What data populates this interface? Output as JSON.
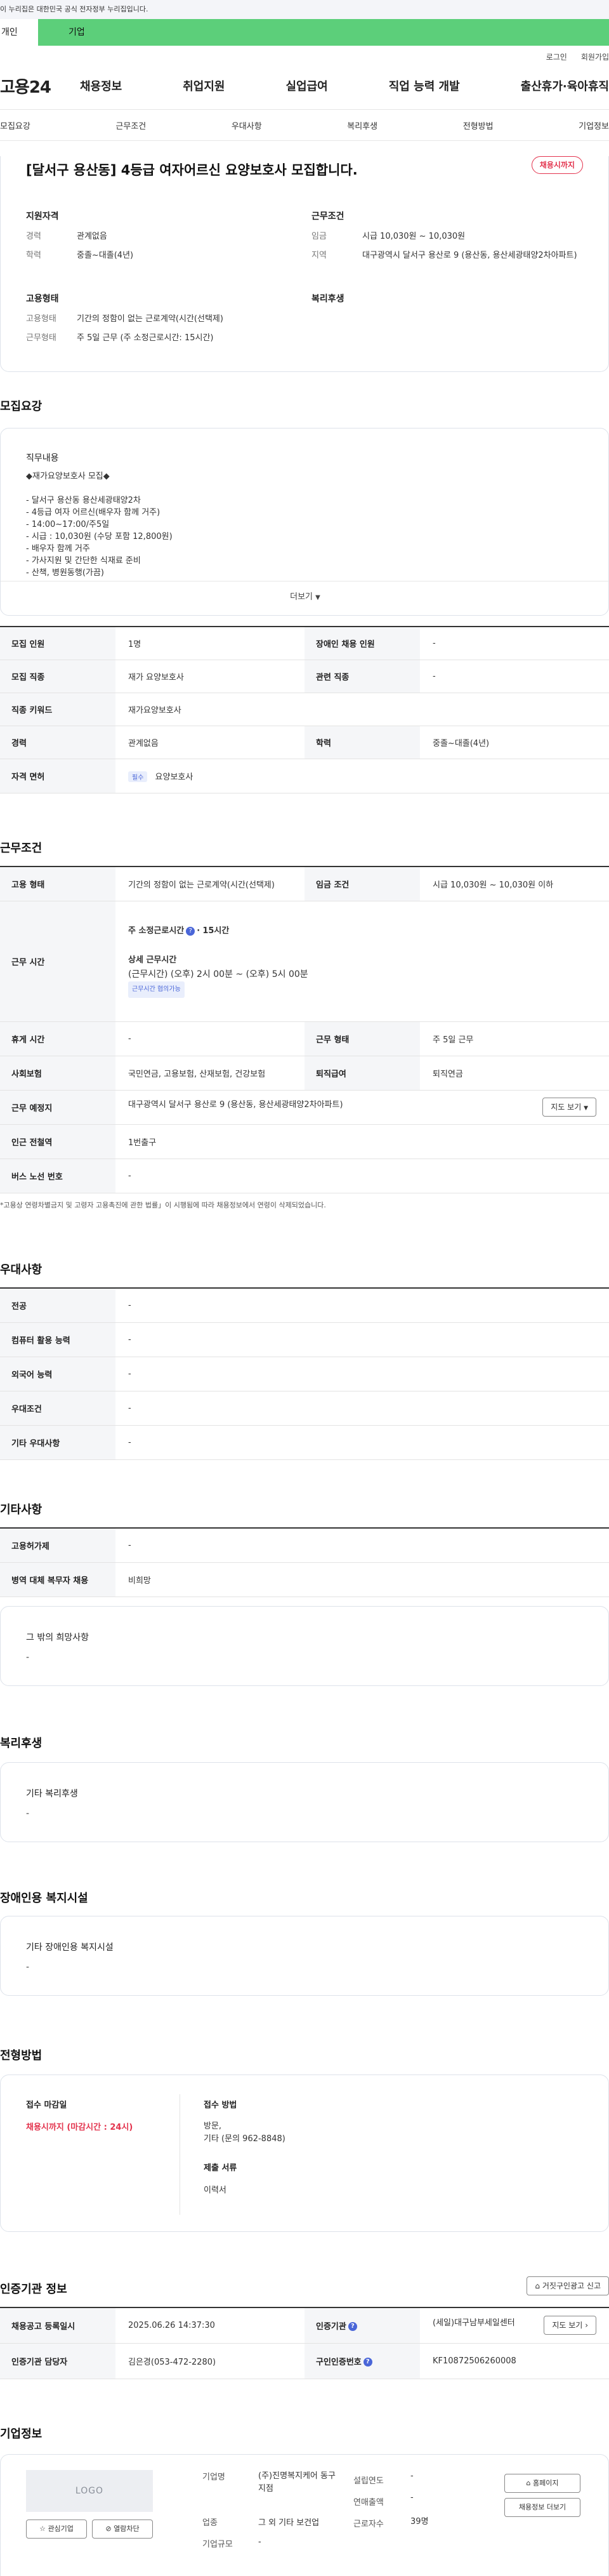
{
  "gov_banner": "이 누리집은 대한민국 공식 전자정부 누리집입니다.",
  "login_tabs": [
    "개인",
    "기업"
  ],
  "util_links": [
    "로그인",
    "회원가입"
  ],
  "logo": "고용24",
  "gnb": [
    "채용정보",
    "취업지원",
    "실업급여",
    "직업 능력 개발",
    "출산휴가·육아휴직"
  ],
  "subnav": [
    "모집요강",
    "근무조건",
    "우대사항",
    "복리후생",
    "전형방법",
    "기업정보"
  ],
  "summary": {
    "title": "[달서구 용산동] 4등급 여자어르신 요양보호사 모집합니다.",
    "status_badge": "채용시까지",
    "qual_head": "지원자격",
    "qual_rows": [
      {
        "k": "경력",
        "v": "관계없음"
      },
      {
        "k": "학력",
        "v": "중졸~대졸(4년)"
      }
    ],
    "work_head": "근무조건",
    "work_rows": [
      {
        "k": "임금",
        "v": "시급 10,030원 ~ 10,030원"
      },
      {
        "k": "지역",
        "v": "대구광역시 달서구 용산로 9 (용산동, 용산세광태양2차아파트)"
      }
    ],
    "emp_head": "고용형태",
    "emp_rows": [
      {
        "k": "고용형태",
        "v": "기간의 정함이 없는 근로계약(시간(선택제)"
      },
      {
        "k": "근무형태",
        "v": "주 5일 근무 (주 소정근로시간: 15시간)"
      }
    ],
    "welfare_head": "복리후생"
  },
  "recruit": {
    "title": "모집요강",
    "duty_label": "직무내용",
    "duty_text": "◆재가요양보호사 모집◆\n\n- 달서구 용산동 용산세광태양2차\n- 4등급 여자 어르신(배우자 함께 거주)\n- 14:00~17:00/주5일\n- 시급 : 10,030원 (수당 포함 12,800원)\n- 배우자 함께 거주\n- 가사지원 및 간단한 식재료 준비\n- 산책, 병원동행(가끔)",
    "more": "더보기",
    "rows": [
      {
        "k1": "모집 인원",
        "v1": "1명",
        "k2": "장애인 채용 인원",
        "v2": "-"
      },
      {
        "k1": "모집 직종",
        "v1": "재가 요양보호사",
        "k2": "관련 직종",
        "v2": "-"
      },
      {
        "k1": "직종 키워드",
        "v1": "재가요양보호사"
      },
      {
        "k1": "경력",
        "v1": "관계없음",
        "k2": "학력",
        "v2": "중졸~대졸(4년)"
      },
      {
        "k1": "자격 면허",
        "chip": "필수",
        "v1": "요양보호사"
      }
    ]
  },
  "conditions": {
    "title": "근무조건",
    "emp_type_k": "고용 형태",
    "emp_type_v": "기간의 정함이 없는 근로계약(시간(선택제)",
    "wage_k": "임금 조건",
    "wage_v": "시급 10,030원 ~ 10,030원 이하",
    "hours_k": "근무 시간",
    "weekly_label": "주 소정근로시간",
    "weekly_value": "15시간",
    "detail_label": "상세 근무시간",
    "detail_value": "(근무시간) (오후) 2시 00분 ~ (오후) 5시 00분",
    "detail_chip": "근무시간 협의가능",
    "rest_k": "휴게 시간",
    "rest_v": "-",
    "worktype_k": "근무 형태",
    "worktype_v": "주 5일 근무",
    "ins_k": "사회보험",
    "ins_v": "국민연금, 고용보험, 산재보험, 건강보험",
    "retire_k": "퇴직급여",
    "retire_v": "퇴직연금",
    "place_k": "근무 예정지",
    "place_v": "대구광역시 달서구 용산로 9 (용산동, 용산세광태양2차아파트)",
    "map_btn": "지도 보기",
    "subway_k": "인근 전철역",
    "subway_v": "1번출구",
    "bus_k": "버스 노선 번호",
    "bus_v": "-",
    "footnote": "*고용상 연령차별금지 및 고령자 고용촉진에 관한 법률」이 시행됨에 따라 채용정보에서 연령이 삭제되었습니다."
  },
  "preferences": {
    "title": "우대사항",
    "rows": [
      {
        "k": "전공",
        "v": "-"
      },
      {
        "k": "컴퓨터 활용 능력",
        "v": "-"
      },
      {
        "k": "외국어 능력",
        "v": "-"
      },
      {
        "k": "우대조건",
        "v": "-"
      },
      {
        "k": "기타 우대사항",
        "v": "-"
      }
    ]
  },
  "etc": {
    "title": "기타사항",
    "rows": [
      {
        "k": "고용허가제",
        "v": "-"
      },
      {
        "k": "병역 대체 복무자 채용",
        "v": "비희망"
      }
    ],
    "other_label": "그 밖의 희망사항",
    "other_value": "-"
  },
  "welfare": {
    "title": "복리후생",
    "label": "기타 복리후생",
    "value": "-"
  },
  "disability": {
    "title": "장애인용 복지시설",
    "label": "기타 장애인용 복지시설",
    "value": "-"
  },
  "selection": {
    "title": "전형방법",
    "deadline_label": "접수 마감일",
    "deadline_value": "채용시까지 (마감시간 : 24시)",
    "method_label": "접수 방법",
    "method_value": "방문,",
    "method_value2": "기타 (문의 962-8848)",
    "docs_label": "제출 서류",
    "docs_value": "이력서"
  },
  "cert": {
    "title": "인증기관 정보",
    "report_btn": "거짓구인광고 신고",
    "reg_k": "채용공고 등록일시",
    "reg_v": "2025.06.26 14:37:30",
    "org_k": "인증기관",
    "org_v": "(세일)대구남부세일센터",
    "map_btn": "지도 보기",
    "mgr_k": "인증기관 담당자",
    "mgr_v": "김은경(053-472-2280)",
    "num_k": "구인인증번호",
    "num_v": "KF10872506260008"
  },
  "company": {
    "title": "기업정보",
    "logo_text": "LOGO",
    "fav_btn": "관심기업",
    "block_btn": "열람차단",
    "name_k": "기업명",
    "name_v": "(주)진명복지케어 동구지점",
    "founded_k": "설립연도",
    "founded_v": "-",
    "sales_k": "연매출액",
    "sales_v": "-",
    "industry_k": "업종",
    "industry_v": "그 외 기타 보건업",
    "staff_k": "근로자수",
    "staff_v": "39명",
    "size_k": "기업규모",
    "size_v": "-",
    "home_btn": "홈페이지",
    "jobs_btn": "채용정보 더보기"
  }
}
